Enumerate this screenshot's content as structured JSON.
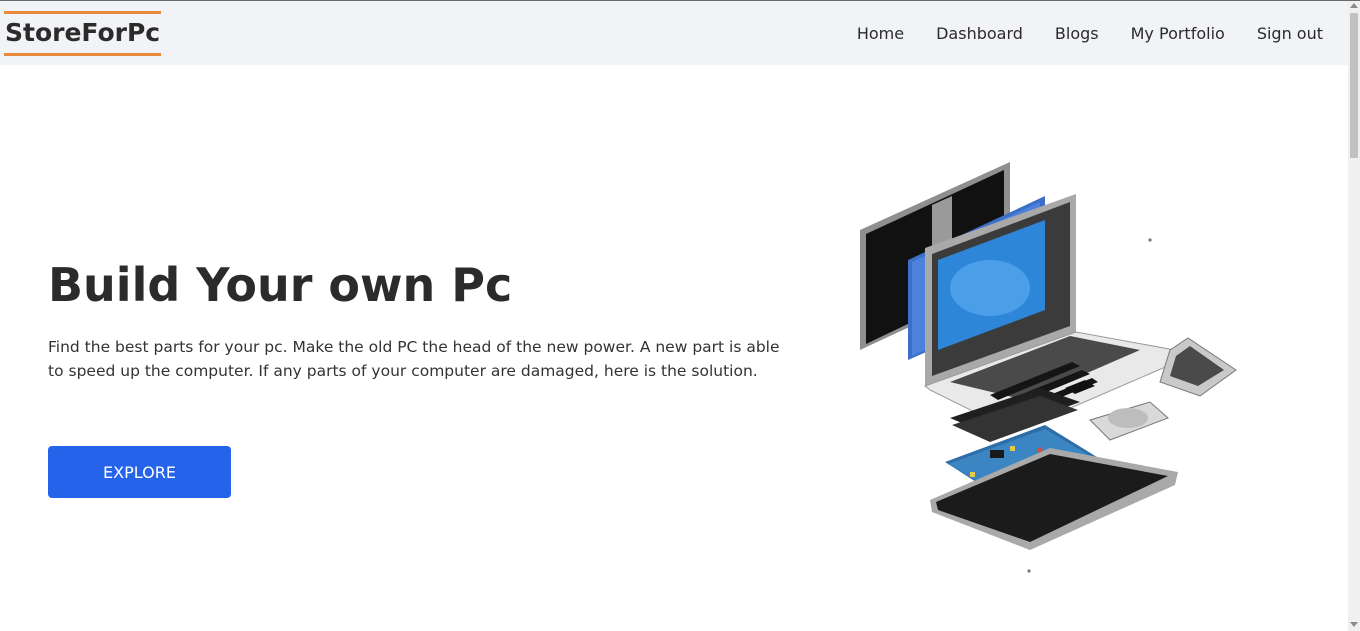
{
  "brand": {
    "name": "StoreForPc",
    "accent": "#e8893a"
  },
  "nav": {
    "items": [
      {
        "label": "Home"
      },
      {
        "label": "Dashboard"
      },
      {
        "label": "Blogs"
      },
      {
        "label": "My Portfolio"
      },
      {
        "label": "Sign out"
      }
    ]
  },
  "hero": {
    "title": "Build Your own Pc",
    "description": "Find the best parts for your pc. Make the old PC the head of the new power. A new part is able to speed up the computer. If any parts of your computer are damaged, here is the solution.",
    "cta_label": "EXPLORE",
    "cta_color": "#2563eb",
    "illustration_icon": "exploded-laptop-illustration"
  }
}
